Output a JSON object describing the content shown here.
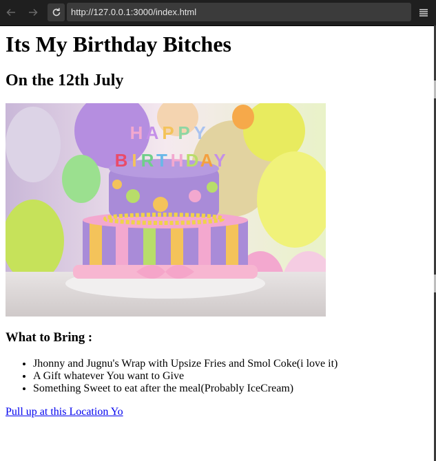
{
  "browser": {
    "url": "http://127.0.0.1:3000/index.html",
    "icons": {
      "back": "arrow-left-icon",
      "forward": "arrow-right-icon",
      "reload": "reload-icon",
      "menu": "hamburger-menu-icon"
    }
  },
  "page": {
    "title": "Its My Birthday Bitches",
    "date_heading": "On the 12th July",
    "image_alt": "Birthday cake",
    "bring_heading": "What to Bring :",
    "bring_items": [
      "Jhonny and Jugnu's Wrap with Upsize Fries and Smol Coke(i love it)",
      "A Gift whatever You want to Give",
      "Something Sweet to eat after the meal(Probably IceCream)"
    ],
    "location_link": "Pull up at this Location Yo"
  },
  "colors": {
    "chrome_bg": "#1f1f1f",
    "urlbar_bg": "#3b3b3b",
    "link": "#0000ee"
  }
}
